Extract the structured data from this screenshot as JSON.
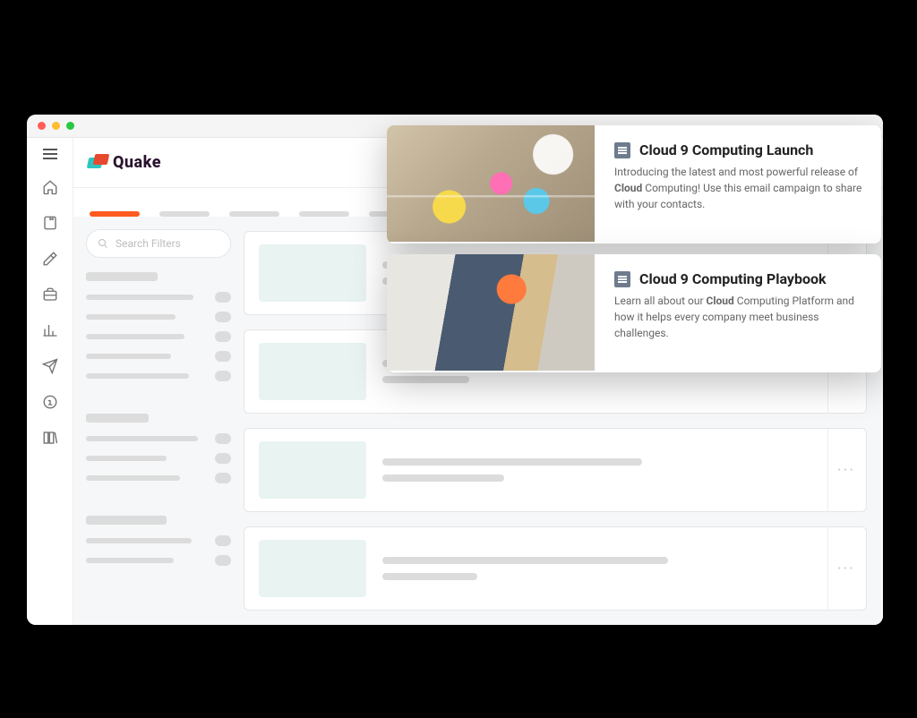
{
  "app": {
    "name": "Quake"
  },
  "search": {
    "placeholder": "Search Filters"
  },
  "popcards": [
    {
      "title": "Cloud 9 Computing Launch",
      "desc_prefix": "Introducing the latest and most powerful release of ",
      "desc_bold": "Cloud",
      "desc_suffix": " Computing! Use this email campaign to share with your contacts."
    },
    {
      "title": "Cloud 9 Computing Playbook",
      "desc_prefix": "Learn all about our ",
      "desc_bold": "Cloud",
      "desc_suffix": " Computing Platform and how it helps every company meet business challenges."
    }
  ]
}
